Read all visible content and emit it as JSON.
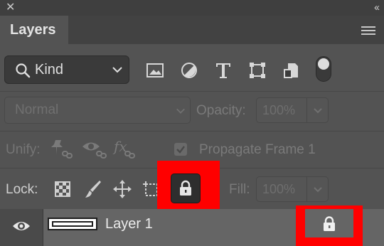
{
  "window": {
    "close_glyph": "✕",
    "collapse_glyph": "‹‹"
  },
  "panel": {
    "tab_label": "Layers"
  },
  "filter": {
    "kind_label": "Kind",
    "icons": [
      "image-filter-icon",
      "adjustment-filter-icon",
      "type-filter-icon",
      "shape-filter-icon",
      "smart-object-filter-icon"
    ],
    "toggle_on": true
  },
  "blending": {
    "mode_label": "Normal",
    "opacity_label": "Opacity:",
    "opacity_value": "100%"
  },
  "unify": {
    "label": "Unify:",
    "icons": [
      "unify-position-icon",
      "unify-visibility-icon",
      "unify-style-icon"
    ],
    "propagate_label": "Propagate Frame 1",
    "propagate_checked": true
  },
  "lock": {
    "label": "Lock:",
    "icons": [
      "lock-transparent-pixels-icon",
      "lock-image-pixels-icon",
      "lock-position-icon",
      "lock-artboard-icon",
      "lock-all-icon"
    ],
    "fill_label": "Fill:",
    "fill_value": "100%"
  },
  "layers": [
    {
      "name": "Layer 1",
      "visible": true,
      "locked": true
    }
  ],
  "colors": {
    "panel_bg": "#535353",
    "selected_layer_bg": "#656565",
    "highlight": "#ff0000"
  }
}
